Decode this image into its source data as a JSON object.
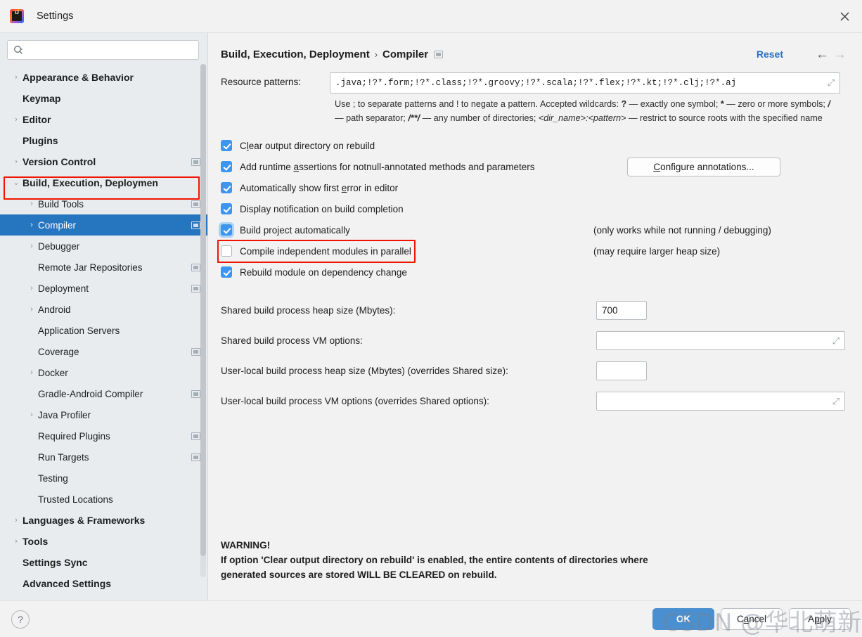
{
  "window": {
    "title": "Settings",
    "logo_icon": "intellij-idea-logo",
    "logo_text": "IJ",
    "close_icon": "✕"
  },
  "sidebar": {
    "search": {
      "placeholder": "",
      "value": "",
      "icon": "search-icon"
    },
    "items": [
      {
        "label": "Appearance & Behavior",
        "level": 0,
        "arrow": "›",
        "bold": true,
        "badge": false,
        "selected": false
      },
      {
        "label": "Keymap",
        "level": 0,
        "arrow": "",
        "bold": true,
        "badge": false,
        "selected": false
      },
      {
        "label": "Editor",
        "level": 0,
        "arrow": "›",
        "bold": true,
        "badge": false,
        "selected": false
      },
      {
        "label": "Plugins",
        "level": 0,
        "arrow": "",
        "bold": true,
        "badge": false,
        "selected": false
      },
      {
        "label": "Version Control",
        "level": 0,
        "arrow": "›",
        "bold": true,
        "badge": true,
        "selected": false
      },
      {
        "label": "Build, Execution, Deploymen",
        "level": 0,
        "arrow": "⌄",
        "bold": true,
        "badge": false,
        "selected": false
      },
      {
        "label": "Build Tools",
        "level": 1,
        "arrow": "›",
        "bold": false,
        "badge": true,
        "selected": false
      },
      {
        "label": "Compiler",
        "level": 1,
        "arrow": "›",
        "bold": false,
        "badge": true,
        "selected": true
      },
      {
        "label": "Debugger",
        "level": 1,
        "arrow": "›",
        "bold": false,
        "badge": false,
        "selected": false
      },
      {
        "label": "Remote Jar Repositories",
        "level": 1,
        "arrow": "",
        "bold": false,
        "badge": true,
        "selected": false
      },
      {
        "label": "Deployment",
        "level": 1,
        "arrow": "›",
        "bold": false,
        "badge": true,
        "selected": false
      },
      {
        "label": "Android",
        "level": 1,
        "arrow": "›",
        "bold": false,
        "badge": false,
        "selected": false
      },
      {
        "label": "Application Servers",
        "level": 1,
        "arrow": "",
        "bold": false,
        "badge": false,
        "selected": false
      },
      {
        "label": "Coverage",
        "level": 1,
        "arrow": "",
        "bold": false,
        "badge": true,
        "selected": false
      },
      {
        "label": "Docker",
        "level": 1,
        "arrow": "›",
        "bold": false,
        "badge": false,
        "selected": false
      },
      {
        "label": "Gradle-Android Compiler",
        "level": 1,
        "arrow": "",
        "bold": false,
        "badge": true,
        "selected": false
      },
      {
        "label": "Java Profiler",
        "level": 1,
        "arrow": "›",
        "bold": false,
        "badge": false,
        "selected": false
      },
      {
        "label": "Required Plugins",
        "level": 1,
        "arrow": "",
        "bold": false,
        "badge": true,
        "selected": false
      },
      {
        "label": "Run Targets",
        "level": 1,
        "arrow": "",
        "bold": false,
        "badge": true,
        "selected": false
      },
      {
        "label": "Testing",
        "level": 1,
        "arrow": "",
        "bold": false,
        "badge": false,
        "selected": false
      },
      {
        "label": "Trusted Locations",
        "level": 1,
        "arrow": "",
        "bold": false,
        "badge": false,
        "selected": false
      },
      {
        "label": "Languages & Frameworks",
        "level": 0,
        "arrow": "›",
        "bold": true,
        "badge": false,
        "selected": false
      },
      {
        "label": "Tools",
        "level": 0,
        "arrow": "›",
        "bold": true,
        "badge": false,
        "selected": false
      },
      {
        "label": "Settings Sync",
        "level": 0,
        "arrow": "",
        "bold": true,
        "badge": false,
        "selected": false
      },
      {
        "label": "Advanced Settings",
        "level": 0,
        "arrow": "",
        "bold": true,
        "badge": false,
        "selected": false
      }
    ]
  },
  "header": {
    "breadcrumb_root": "Build, Execution, Deployment",
    "breadcrumb_sep": "›",
    "breadcrumb_leaf": "Compiler",
    "badge_icon": "project-scope-icon",
    "reset_label": "Reset",
    "back_icon": "←",
    "forward_icon": "→"
  },
  "resource_patterns": {
    "label": "Resource patterns:",
    "value": ".java;!?*.form;!?*.class;!?*.groovy;!?*.scala;!?*.flex;!?*.kt;!?*.clj;!?*.aj",
    "expand_icon": "⤢",
    "help_line1_a": "Use ; to separate patterns and ! to negate a pattern. Accepted wildcards: ",
    "help_q": "?",
    "help_line1_b": " — exactly one symbol; ",
    "help_star": "*",
    "help_line1_c": " — zero or more symbols; ",
    "help_slash": "/",
    "help_line2_a": " — path separator; ",
    "help_dstar": "/**/",
    "help_line2_b": " — any number of directories; ",
    "help_dir": "<dir_name>:<pattern>",
    "help_line2_c": " — restrict to source roots with the specified name"
  },
  "checkboxes": [
    {
      "label_pre": "C",
      "label_u": "l",
      "label_post": "ear output directory on rebuild",
      "checked": true,
      "focused": false,
      "note": "",
      "button": ""
    },
    {
      "label_pre": "Add runtime ",
      "label_u": "a",
      "label_post": "ssertions for notnull-annotated methods and parameters",
      "checked": true,
      "focused": false,
      "note": "",
      "button": "Configure annotations..."
    },
    {
      "label_pre": "Automatically show first ",
      "label_u": "e",
      "label_post": "rror in editor",
      "checked": true,
      "focused": false,
      "note": "",
      "button": ""
    },
    {
      "label_pre": "Display notification on build completion",
      "label_u": "",
      "label_post": "",
      "checked": true,
      "focused": false,
      "note": "",
      "button": ""
    },
    {
      "label_pre": "Build project automatically",
      "label_u": "",
      "label_post": "",
      "checked": true,
      "focused": true,
      "note": "(only works while not running / debugging)",
      "button": ""
    },
    {
      "label_pre": "Compile independent modules in parallel",
      "label_u": "",
      "label_post": "",
      "checked": false,
      "focused": false,
      "note": "(may require larger heap size)",
      "button": ""
    },
    {
      "label_pre": "Rebuild module on dependency change",
      "label_u": "",
      "label_post": "",
      "checked": true,
      "focused": false,
      "note": "",
      "button": ""
    }
  ],
  "configure_annotations_button": {
    "label_pre": "C",
    "label_u": "C",
    "label_post": "onfigure annotations..."
  },
  "fields": [
    {
      "label": "Shared build process heap size (Mbytes):",
      "value": "700",
      "wide": false,
      "expand": false
    },
    {
      "label": "Shared build process VM options:",
      "value": "",
      "wide": true,
      "expand": true
    },
    {
      "label": "User-local build process heap size (Mbytes) (overrides Shared size):",
      "value": "",
      "wide": false,
      "expand": false
    },
    {
      "label": "User-local build process VM options (overrides Shared options):",
      "value": "",
      "wide": true,
      "expand": true
    }
  ],
  "warning": {
    "line1": "WARNING!",
    "line2": "If option 'Clear output directory on rebuild' is enabled, the entire contents of directories where",
    "line3": "generated sources are stored WILL BE CLEARED on rebuild."
  },
  "footer": {
    "help_icon": "?",
    "ok_label": "OK",
    "cancel_pre": "C",
    "cancel_u": "a",
    "cancel_post": "ncel",
    "apply_pre": "A",
    "apply_u": "p",
    "apply_post": "ply",
    "cancel_label": "Cancel",
    "apply_label": "Apply"
  },
  "watermark": {
    "text": "CSDN @华北萌新程序员"
  },
  "colors": {
    "accent_blue": "#2675bf",
    "checkbox_blue": "#3d95ef",
    "link_blue": "#2a70c0",
    "annotation_red": "#f01400",
    "sidebar_bg": "#e8ecef",
    "main_bg": "#f2f2f2",
    "primary_button": "#4a8fd0"
  }
}
